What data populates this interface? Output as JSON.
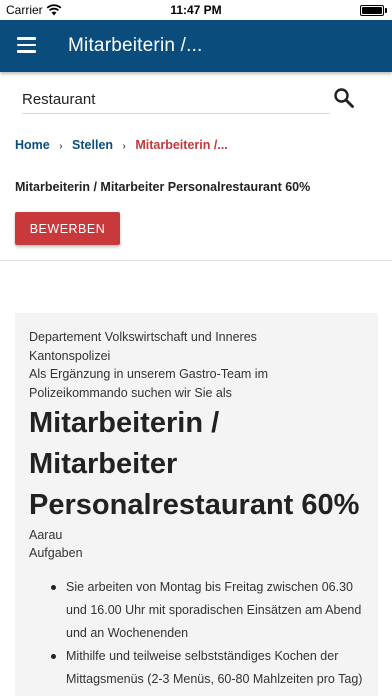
{
  "status_bar": {
    "carrier": "Carrier",
    "time": "11:47 PM"
  },
  "app_bar": {
    "title": "Mitarbeiterin /...",
    "color": "#0a4d7c"
  },
  "search": {
    "value": "Restaurant",
    "icon": "search-icon"
  },
  "breadcrumb": {
    "items": [
      "Home",
      "Stellen"
    ],
    "current": "Mitarbeiterin /..."
  },
  "page": {
    "title": "Mitarbeiterin / Mitarbeiter Personalrestaurant 60%",
    "apply_label": "BEWERBEN",
    "accent": "#c8393b"
  },
  "posting": {
    "department": "Departement Volkswirtschaft und Inneres",
    "unit": "Kantonspolizei",
    "intro": "Als Ergänzung in unserem Gastro-Team im Polizeikommando suchen wir Sie als",
    "headline": "Mitarbeiterin / Mitarbeiter Personalrestaurant 60%",
    "location": "Aarau",
    "tasks_label": "Aufgaben",
    "tasks": [
      "Sie arbeiten von Montag bis Freitag zwischen 06.30 und 16.00 Uhr mit sporadischen Einsätzen am Abend und an Wochenenden",
      "Mithilfe und teilweise selbstständiges Kochen der Mittagsmenüs (2-3 Menüs, 60-80 Mahlzeiten pro Tag)"
    ]
  }
}
